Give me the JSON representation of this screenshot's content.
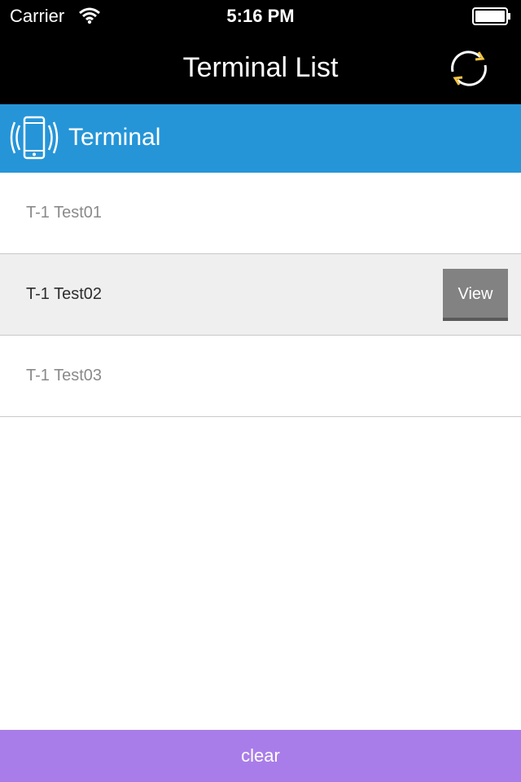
{
  "status_bar": {
    "carrier": "Carrier",
    "time": "5:16 PM",
    "wifi_icon": "wifi-icon",
    "battery_icon": "battery-icon"
  },
  "nav": {
    "title": "Terminal List",
    "refresh_icon": "refresh-icon"
  },
  "section": {
    "title": "Terminal",
    "icon": "phone-vibrate-icon",
    "color": "#2595d8"
  },
  "terminals": [
    {
      "label": "T-1 Test01"
    },
    {
      "label": "T-1 Test02",
      "action": "View"
    },
    {
      "label": "T-1 Test03"
    }
  ],
  "footer": {
    "clear_label": "clear",
    "color": "#a97de9"
  }
}
